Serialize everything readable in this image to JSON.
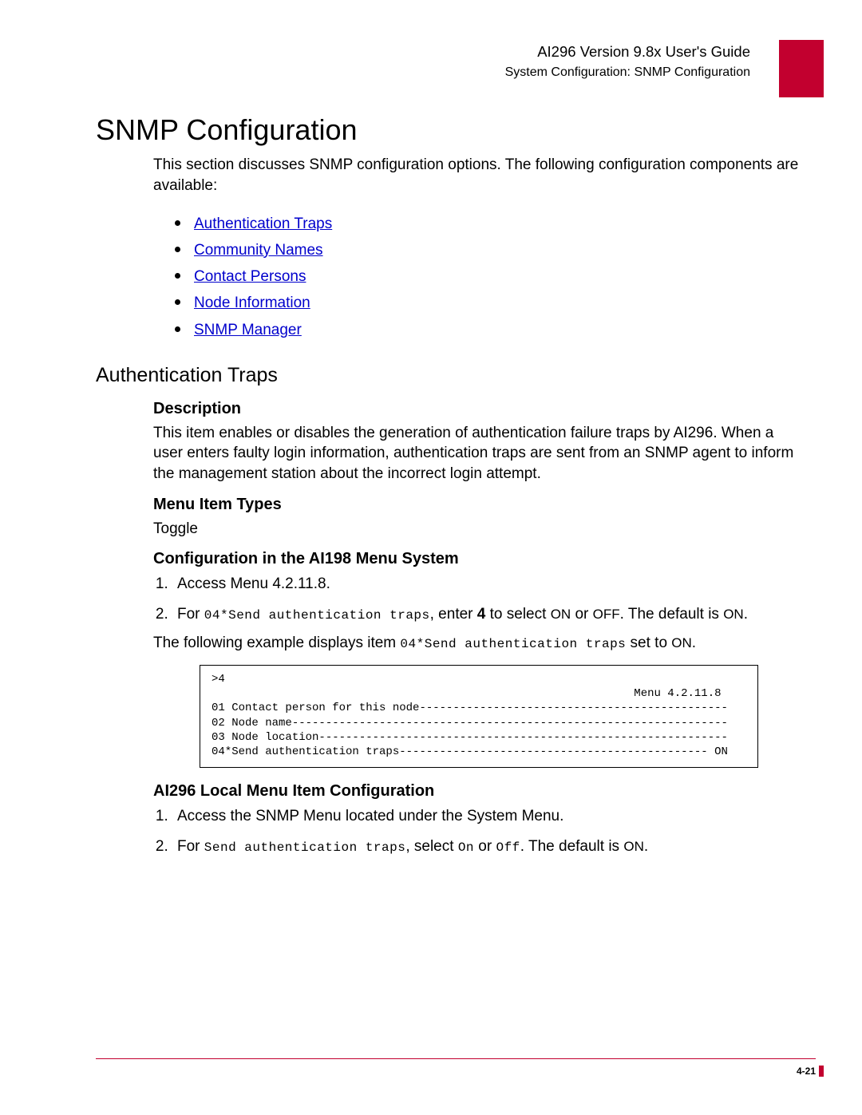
{
  "header": {
    "title": "AI296 Version 9.8x User's Guide",
    "subtitle": "System Configuration: SNMP Configuration"
  },
  "h1": "SNMP Configuration",
  "intro": "This section discusses SNMP configuration options. The following configuration components are available:",
  "links": [
    "Authentication Traps",
    "Community Names",
    "Contact Persons",
    "Node Information",
    "SNMP Manager"
  ],
  "auth": {
    "heading": "Authentication Traps",
    "desc_h": "Description",
    "desc": "This item enables or disables the generation of authentication failure traps by AI296. When a user enters faulty login information, authentication traps are sent from an SNMP agent to inform the management station about the incorrect login attempt.",
    "types_h": "Menu Item Types",
    "types": "Toggle",
    "cfg198_h": "Configuration in the AI198 Menu System",
    "step198_1": "Access Menu 4.2.11.8.",
    "step198_2a": "For ",
    "step198_2_code": "04*Send authentication traps",
    "step198_2b": ", enter ",
    "step198_2_bold": "4",
    "step198_2c": " to select ",
    "step198_2_on": "ON",
    "step198_2d": " or ",
    "step198_2_off": "OFF",
    "step198_2e": ". The default is ",
    "step198_2_on2": "ON",
    "step198_2f": ".",
    "example_lead_a": "The following example displays item ",
    "example_lead_code": "04*Send authentication traps",
    "example_lead_b": " set to ",
    "example_lead_on": "ON",
    "example_lead_c": ".",
    "codebox": ">4\n                                                               Menu 4.2.11.8\n01 Contact person for this node----------------------------------------------\n02 Node name-----------------------------------------------------------------\n03 Node location-------------------------------------------------------------\n04*Send authentication traps---------------------------------------------- ON",
    "local_h": "AI296 Local Menu Item Configuration",
    "local_1": "Access the SNMP Menu located under the System Menu.",
    "local_2a": "For ",
    "local_2_code": "Send authentication traps",
    "local_2b": ", select ",
    "local_2_on": "On",
    "local_2c": " or ",
    "local_2_off": "Off",
    "local_2d": ". The default is ",
    "local_2_on2": "ON",
    "local_2e": "."
  },
  "footer": {
    "page": "4-21"
  }
}
